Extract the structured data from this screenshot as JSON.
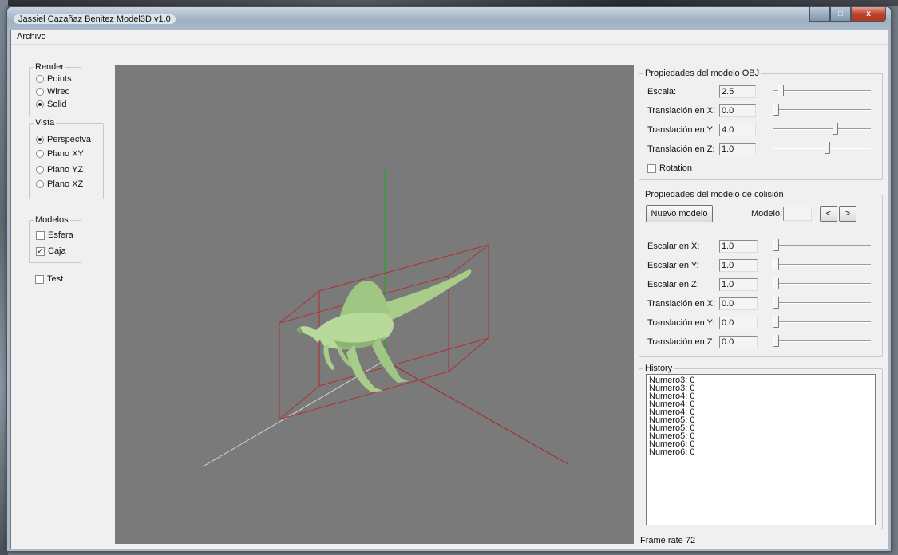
{
  "window": {
    "title": "Jassiel Cazañaz Benitez Model3D v1.0"
  },
  "controls": {
    "minimize": "–",
    "maximize": "□",
    "close": "x"
  },
  "menu": {
    "archivo": "Archivo"
  },
  "render": {
    "label": "Render",
    "options": [
      "Points",
      "Wired",
      "Solid"
    ],
    "selected": "Solid"
  },
  "vista": {
    "label": "Vista",
    "options": [
      "Perspectva",
      "Plano XY",
      "Plano YZ",
      "Plano XZ"
    ],
    "selected": "Perspectva"
  },
  "modelos": {
    "label": "Modelos",
    "options": [
      {
        "label": "Esfera",
        "checked": false
      },
      {
        "label": "Caja",
        "checked": true
      }
    ]
  },
  "test": {
    "label": "Test",
    "checked": false
  },
  "obj_props": {
    "label": "Propiedades del modelo OBJ",
    "rows": [
      {
        "label": "Escala:",
        "value": "2.5",
        "slider": 0.05
      },
      {
        "label": "Translación en X:",
        "value": "0.0",
        "slider": 0.0
      },
      {
        "label": "Translación en Y:",
        "value": "4.0",
        "slider": 0.62
      },
      {
        "label": "Translación en Z:",
        "value": "1.0",
        "slider": 0.55
      }
    ],
    "rotation": {
      "label": "Rotation",
      "checked": false
    }
  },
  "collision_props": {
    "label": "Propiedades del modelo de colisión",
    "new_model_button": "Nuevo modelo",
    "modelo_label": "Modelo:",
    "modelo_value": "",
    "prev": "<",
    "next": ">",
    "rows": [
      {
        "label": "Escalar en X:",
        "value": "1.0",
        "slider": 0.0
      },
      {
        "label": "Escalar en Y:",
        "value": "1.0",
        "slider": 0.0
      },
      {
        "label": "Escalar en Z:",
        "value": "1.0",
        "slider": 0.0
      },
      {
        "label": "Translación en X:",
        "value": "0.0",
        "slider": 0.0
      },
      {
        "label": "Translación en Y:",
        "value": "0.0",
        "slider": 0.0
      },
      {
        "label": "Translación en Z:",
        "value": "0.0",
        "slider": 0.0
      }
    ]
  },
  "history": {
    "label": "History",
    "lines": [
      "Numero3: 0",
      "Numero3: 0",
      "Numero4: 0",
      "Numero4: 0",
      "Numero4: 0",
      "Numero5: 0",
      "Numero5: 0",
      "Numero5: 0",
      "Numero6: 0",
      "Numero6: 0"
    ]
  },
  "status": {
    "frame_rate": "Frame rate 72"
  },
  "colors": {
    "viewport_bg": "#7a7a7a",
    "y_axis": "#2fa32f",
    "x_axis": "#b02020",
    "z_axis": "#d8d8d8",
    "box": "#b03030",
    "model": "#b7d99a"
  }
}
